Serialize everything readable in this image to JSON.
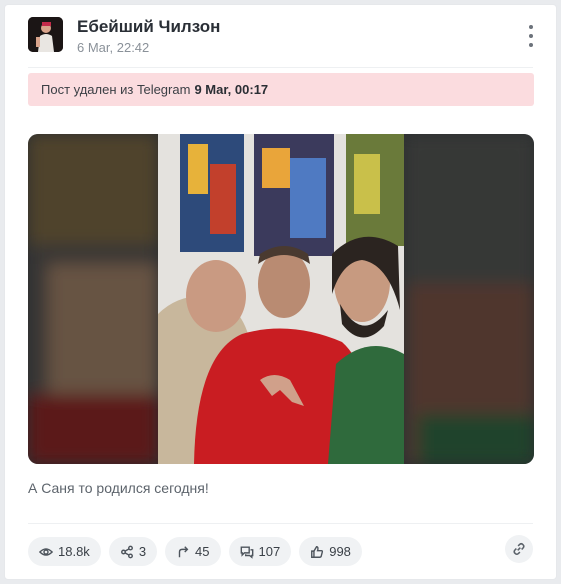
{
  "post": {
    "author": "Ебейший Чилзон",
    "timestamp": "6 Mar, 22:42",
    "notice_text": "Пост удален из Telegram",
    "notice_time": "9 Mar, 00:17",
    "caption": "А Саня то родился сегодня!"
  },
  "stats": {
    "views": "18.8k",
    "shares": "3",
    "forwards": "45",
    "comments": "107",
    "likes": "998"
  },
  "colors": {
    "notice_bg": "#fbdcdf",
    "pill_bg": "#f0f2f4"
  },
  "icons": [
    "more-icon",
    "eye-icon",
    "share-icon",
    "forward-icon",
    "comment-icon",
    "like-icon",
    "link-icon"
  ]
}
